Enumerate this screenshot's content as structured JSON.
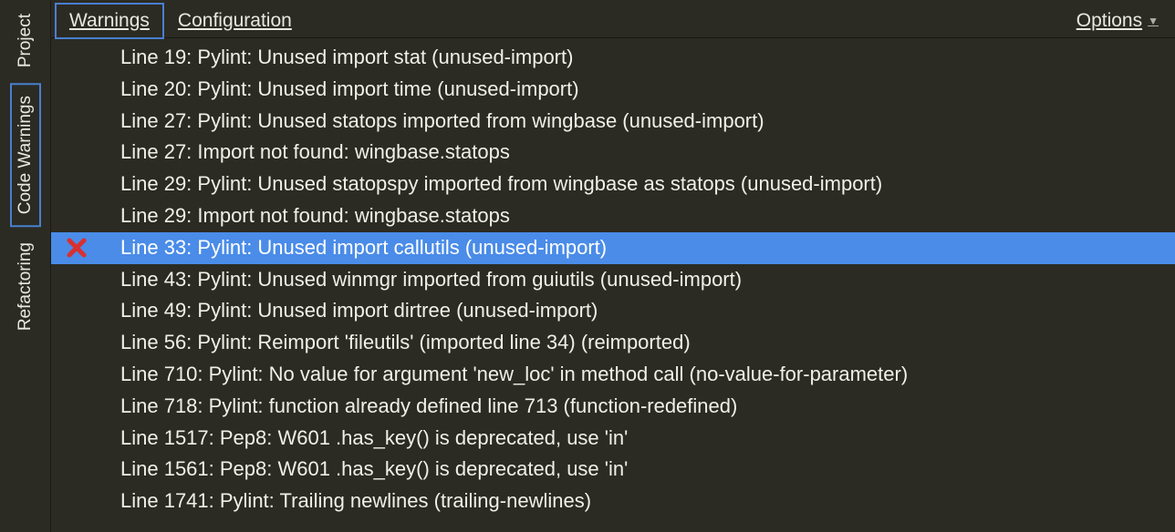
{
  "sidebar": {
    "tabs": [
      {
        "label": "Project",
        "active": false
      },
      {
        "label": "Code Warnings",
        "active": true
      },
      {
        "label": "Refactoring",
        "active": false
      }
    ]
  },
  "top_tabs": {
    "items": [
      {
        "label": "Warnings",
        "active": true
      },
      {
        "label": "Configuration",
        "active": false
      }
    ],
    "options_label": "Options"
  },
  "warnings": [
    {
      "text": "Line 19: Pylint: Unused import stat (unused-import)",
      "selected": false,
      "has_x": false
    },
    {
      "text": "Line 20: Pylint: Unused import time (unused-import)",
      "selected": false,
      "has_x": false
    },
    {
      "text": "Line 27: Pylint: Unused statops imported from wingbase (unused-import)",
      "selected": false,
      "has_x": false
    },
    {
      "text": "Line 27: Import not found: wingbase.statops",
      "selected": false,
      "has_x": false
    },
    {
      "text": "Line 29: Pylint: Unused statopspy imported from wingbase as statops (unused-import)",
      "selected": false,
      "has_x": false
    },
    {
      "text": "Line 29: Import not found: wingbase.statops",
      "selected": false,
      "has_x": false
    },
    {
      "text": "Line 33: Pylint: Unused import callutils (unused-import)",
      "selected": true,
      "has_x": true
    },
    {
      "text": "Line 43: Pylint: Unused winmgr imported from guiutils (unused-import)",
      "selected": false,
      "has_x": false
    },
    {
      "text": "Line 49: Pylint: Unused import dirtree (unused-import)",
      "selected": false,
      "has_x": false
    },
    {
      "text": "Line 56: Pylint: Reimport 'fileutils' (imported line 34) (reimported)",
      "selected": false,
      "has_x": false
    },
    {
      "text": "Line 710: Pylint: No value for argument 'new_loc' in method call (no-value-for-parameter)",
      "selected": false,
      "has_x": false
    },
    {
      "text": "Line 718: Pylint: function already defined line 713 (function-redefined)",
      "selected": false,
      "has_x": false
    },
    {
      "text": "Line 1517: Pep8: W601 .has_key() is deprecated, use 'in'",
      "selected": false,
      "has_x": false
    },
    {
      "text": "Line 1561: Pep8: W601 .has_key() is deprecated, use 'in'",
      "selected": false,
      "has_x": false
    },
    {
      "text": "Line 1741: Pylint: Trailing newlines (trailing-newlines)",
      "selected": false,
      "has_x": false
    }
  ]
}
